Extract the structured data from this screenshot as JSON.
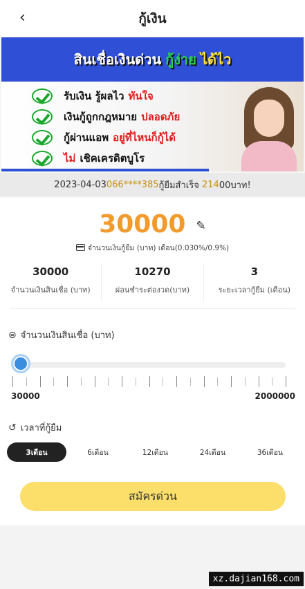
{
  "header": {
    "back_icon": "chevron-left-icon",
    "back_glyph": "‹",
    "title": "กู้เงิน"
  },
  "banner": {
    "headline_part1": "สินเชื่อเงินด่วน",
    "headline_part2": "กู้ง่าย",
    "headline_part3": "ได้ไว",
    "items": [
      {
        "black": "รับเงิน รู้ผลไว",
        "red": "ทันใจ"
      },
      {
        "black": "เงินกู้ถูกกฎหมาย",
        "red": "ปลอดภัย"
      },
      {
        "black": "กู้ผ่านแอพ",
        "red": "อยู่ที่ไหนก็กู้ได้"
      },
      {
        "red": "ไม่",
        "black": "เชิคเครดิตบูโร"
      }
    ]
  },
  "ticker": {
    "prefix": "2023-04-03",
    "phone": "066****385",
    "middle": "กู้ยืมสำเร็จ",
    "amount": "214",
    "suffix": " 00บาท!"
  },
  "loan": {
    "amount": "30000",
    "edit_icon": "edit-icon",
    "rate_text": "จำนวนเงินกู้ยืม (บาท) เดือน(0.030%/0.9%)",
    "stats": [
      {
        "value": "30000",
        "label": "จำนวนเงินสินเชื่อ (บาท)"
      },
      {
        "value": "10270",
        "label": "ผ่อนชำระต่องวด(บาท)"
      },
      {
        "value": "3",
        "label": "ระยะเวลากู้ยืม (เดือน)"
      }
    ]
  },
  "amount_section": {
    "icon": "coins-icon",
    "title": "จำนวนเงินสินเชื่อ (บาท)",
    "min_label": "30000",
    "max_label": "2000000",
    "slider_fraction": 0.0
  },
  "term_section": {
    "icon": "history-icon",
    "title": "เวลาที่กู้ยืม",
    "options": [
      "3เดือน",
      "6เดือน",
      "12เดือน",
      "24เดือน",
      "36เดือน"
    ],
    "selected": "3เดือน"
  },
  "apply_button": "สมัครด่วน",
  "watermark": "xz.dajian168.com",
  "colors": {
    "accent": "#f39a2c",
    "slider": "#3b8de0",
    "button": "#fbdf6a",
    "banner_blue": "#2f4fd6"
  }
}
